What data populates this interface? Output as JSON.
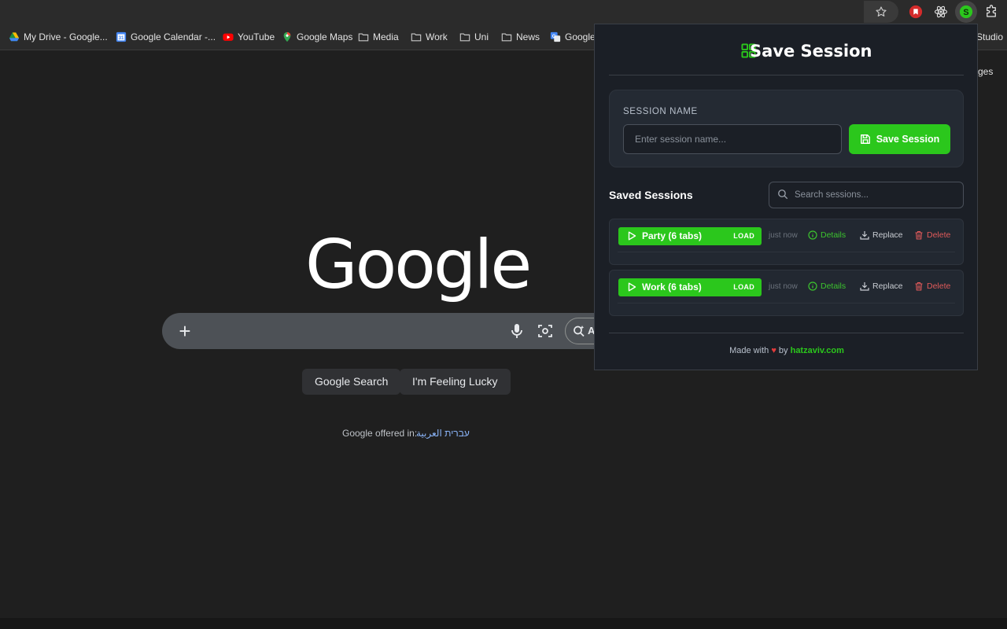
{
  "toolbar": {
    "icons": [
      "star-icon",
      "red-extension-icon",
      "react-extension-icon",
      "save-session-extension-icon",
      "puzzle-extensions-icon"
    ]
  },
  "bookmarks": [
    {
      "label": "My Drive - Google...",
      "icon": "drive-icon"
    },
    {
      "label": "Google Calendar -...",
      "icon": "calendar-icon"
    },
    {
      "label": "YouTube",
      "icon": "youtube-icon"
    },
    {
      "label": "Google Maps",
      "icon": "maps-icon"
    },
    {
      "label": "Media",
      "icon": "folder-icon"
    },
    {
      "label": "Work",
      "icon": "folder-icon"
    },
    {
      "label": "Uni",
      "icon": "folder-icon"
    },
    {
      "label": "News",
      "icon": "folder-icon"
    },
    {
      "label": "Google",
      "icon": "translate-icon"
    }
  ],
  "bookmarks_overflow": "Studio",
  "page_peek": "ges",
  "google": {
    "logo": "Google",
    "ai_mode_fragment": "A",
    "search_button": "Google Search",
    "lucky_button": "I'm Feeling Lucky",
    "offered_in": "Google offered in:",
    "languages": [
      "עברית",
      "العربية"
    ]
  },
  "popup": {
    "title": "Save Session",
    "session_name_label": "SESSION NAME",
    "session_name_placeholder": "Enter session name...",
    "save_button": "Save Session",
    "saved_sessions_title": "Saved Sessions",
    "search_placeholder": "Search sessions...",
    "sessions": [
      {
        "name": "Party (6 tabs)",
        "load": "LOAD",
        "time": "just now",
        "details": "Details",
        "replace": "Replace",
        "delete": "Delete"
      },
      {
        "name": "Work (6 tabs)",
        "load": "LOAD",
        "time": "just now",
        "details": "Details",
        "replace": "Replace",
        "delete": "Delete"
      }
    ],
    "footer": {
      "made_with": "Made with",
      "heart": "♥",
      "by": "by",
      "link": "hatzaviv.com"
    }
  },
  "colors": {
    "accent_green": "#2bc71c",
    "delete_red": "#e05a5a",
    "popup_bg": "#1b1f26"
  }
}
